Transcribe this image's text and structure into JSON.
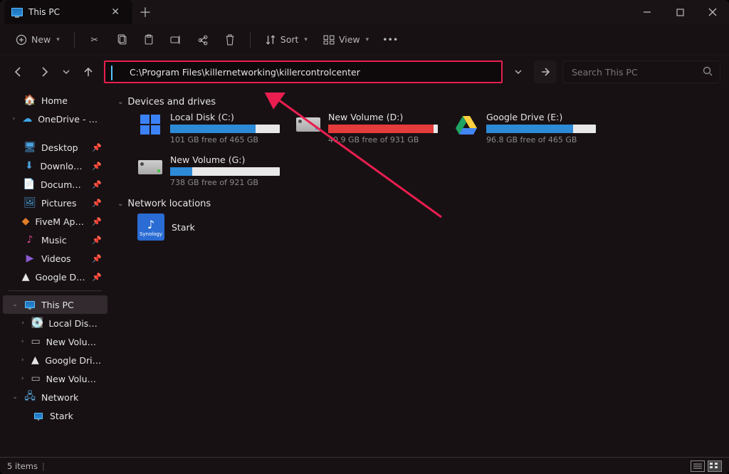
{
  "tab": {
    "title": "This PC"
  },
  "toolbar": {
    "new_label": "New",
    "sort_label": "Sort",
    "view_label": "View"
  },
  "address": {
    "path": "C:\\Program Files\\killernetworking\\killercontrolcenter"
  },
  "search": {
    "placeholder": "Search This PC"
  },
  "sidebar": {
    "home": "Home",
    "onedrive": "OneDrive - Personal",
    "quick": [
      {
        "label": "Desktop",
        "icon": "desktop"
      },
      {
        "label": "Downloads",
        "icon": "downloads"
      },
      {
        "label": "Documents",
        "icon": "documents"
      },
      {
        "label": "Pictures",
        "icon": "pictures"
      },
      {
        "label": "FiveM Application",
        "icon": "fivem"
      },
      {
        "label": "Music",
        "icon": "music"
      },
      {
        "label": "Videos",
        "icon": "videos"
      },
      {
        "label": "Google Drive (E:)",
        "icon": "gdrive"
      }
    ],
    "thispc": "This PC",
    "drives": [
      {
        "label": "Local Disk (C:)"
      },
      {
        "label": "New Volume (D:)"
      },
      {
        "label": "Google Drive (E:)"
      },
      {
        "label": "New Volume (G:)"
      }
    ],
    "network": "Network",
    "netitems": [
      {
        "label": "Stark"
      }
    ]
  },
  "sections": {
    "devices_title": "Devices and drives",
    "network_title": "Network locations"
  },
  "drives": [
    {
      "name": "Local Disk (C:)",
      "stat": "101 GB free of 465 GB",
      "fill_pct": 78,
      "color": "#2d8ad6",
      "icon": "winlogo"
    },
    {
      "name": "New Volume (D:)",
      "stat": "40.9 GB free of 931 GB",
      "fill_pct": 96,
      "color": "#e43b3b",
      "icon": "hdd"
    },
    {
      "name": "Google Drive (E:)",
      "stat": "96.8 GB free of 465 GB",
      "fill_pct": 79,
      "color": "#2d8ad6",
      "icon": "gdrive"
    },
    {
      "name": "New Volume (G:)",
      "stat": "738 GB free of 921 GB",
      "fill_pct": 20,
      "color": "#2d8ad6",
      "icon": "hdd-green"
    }
  ],
  "network_locations": [
    {
      "name": "Stark"
    }
  ],
  "status": {
    "items": "5 items"
  }
}
